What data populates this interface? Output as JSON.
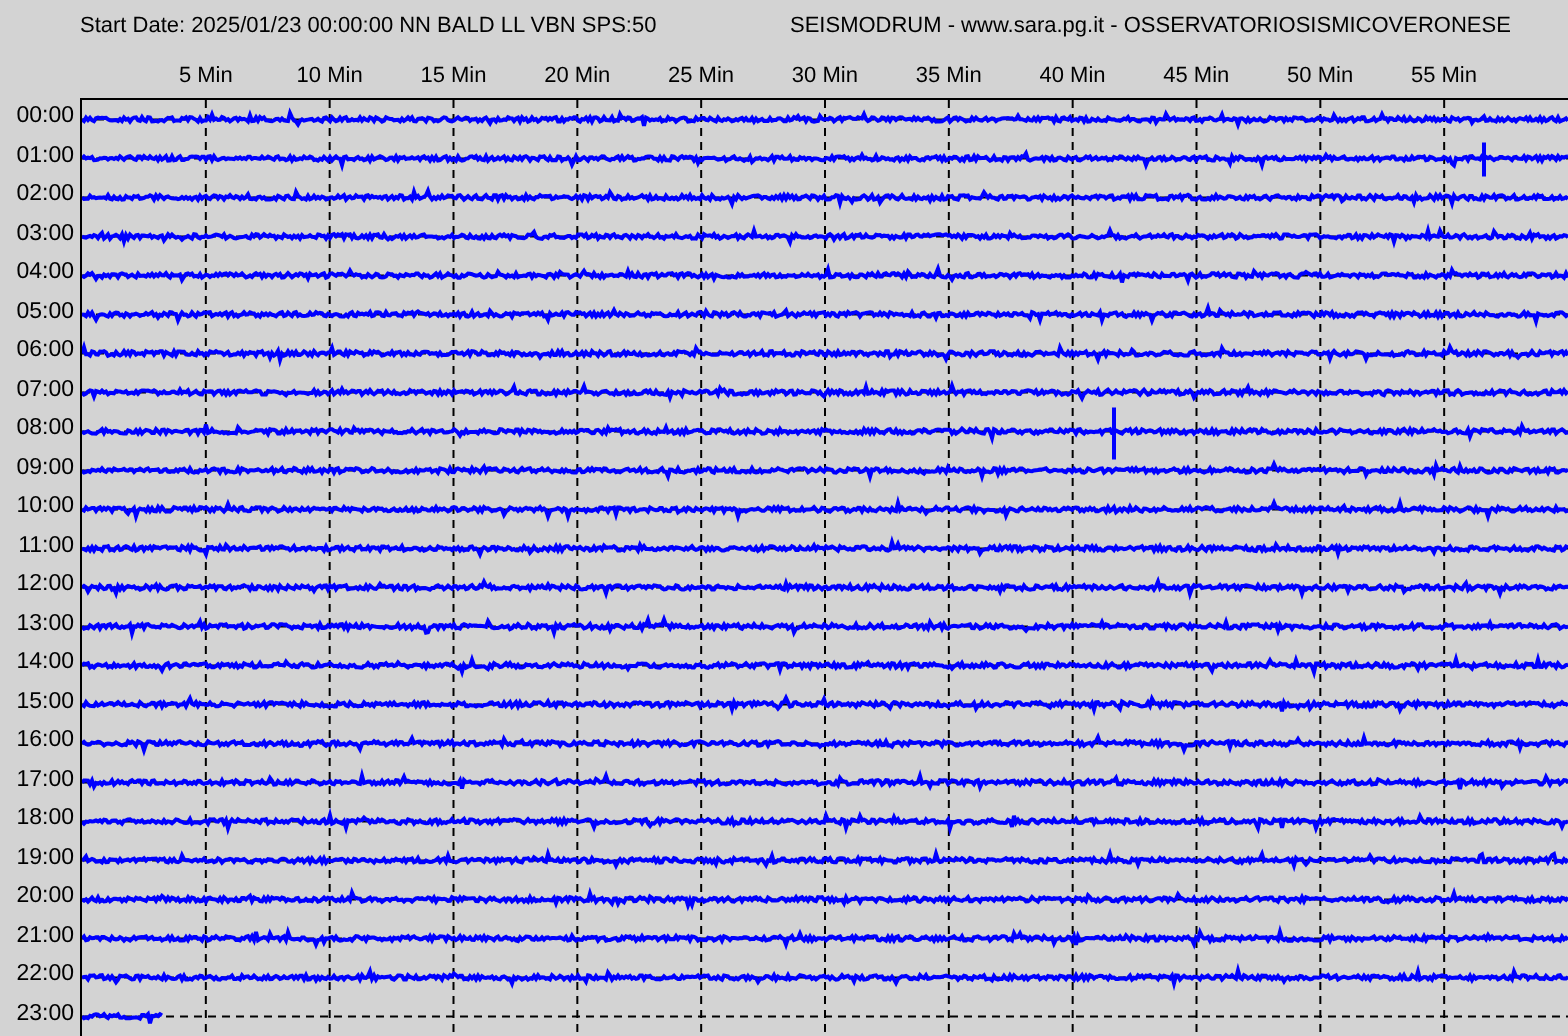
{
  "header": {
    "title": "Start Date: 2025/01/23 00:00:00 NN BALD LL VBN SPS:50",
    "source": "SEISMODRUM - www.sara.pg.it - OSSERVATORIOSISMICOVERONESE"
  },
  "minute_labels": [
    "5 Min",
    "10 Min",
    "15 Min",
    "20 Min",
    "25 Min",
    "30 Min",
    "35 Min",
    "40 Min",
    "45 Min",
    "50 Min",
    "55 Min"
  ],
  "rows": [
    {
      "time": "00:00",
      "level": 1
    },
    {
      "time": "01:00",
      "level": 1
    },
    {
      "time": "02:00",
      "level": 1
    },
    {
      "time": "03:00",
      "level": 1
    },
    {
      "time": "04:00",
      "level": 1
    },
    {
      "time": "05:00",
      "level": 1
    },
    {
      "time": "06:00",
      "level": 1
    },
    {
      "time": "07:00",
      "level": 1
    },
    {
      "time": "08:00",
      "level": 1
    },
    {
      "time": "09:00",
      "level": 1
    },
    {
      "time": "10:00",
      "level": 1
    },
    {
      "time": "11:00",
      "level": 1
    },
    {
      "time": "12:00",
      "level": 1
    },
    {
      "time": "13:00",
      "level": 1
    },
    {
      "time": "14:00",
      "level": 1
    },
    {
      "time": "15:00",
      "level": 1
    },
    {
      "time": "16:00",
      "level": 1
    },
    {
      "time": "17:00",
      "level": 1
    },
    {
      "time": "18:00",
      "level": 1
    },
    {
      "time": "19:00",
      "level": 1
    },
    {
      "time": "20:00",
      "level": 1
    },
    {
      "time": "21:00",
      "level": 1
    },
    {
      "time": "22:00",
      "level": 1
    },
    {
      "time": "23:00",
      "level": 0.054
    }
  ]
}
